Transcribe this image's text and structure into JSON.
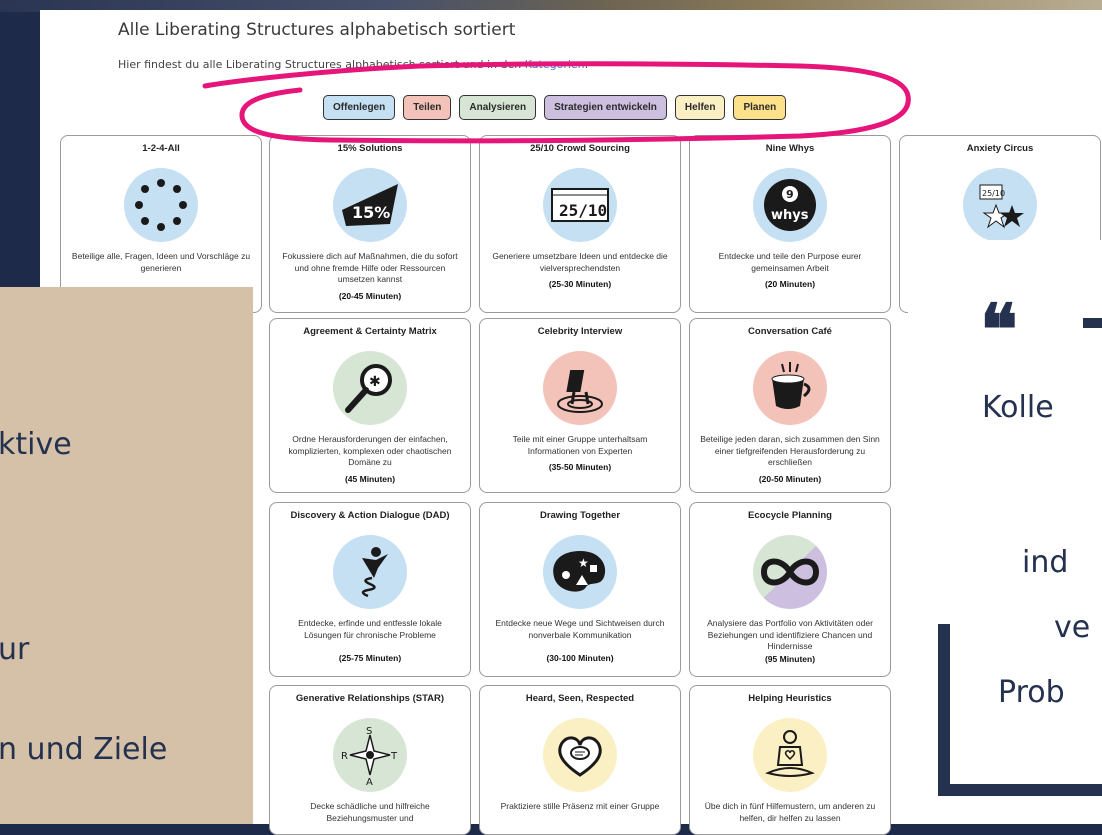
{
  "page": {
    "title": "Alle Liberating Structures alphabetisch sortiert",
    "intro_text": "Hier findest du alle Liberating Structures alphabetisch sortiert und in den",
    "intro_link": "Kategorien",
    "intro_colon": ":"
  },
  "categories": [
    {
      "label": "Offenlegen",
      "color": "#c5dff3"
    },
    {
      "label": "Teilen",
      "color": "#f3c2b8"
    },
    {
      "label": "Analysieren",
      "color": "#d7e6d4"
    },
    {
      "label": "Strategien entwickeln",
      "color": "#cdbfe0"
    },
    {
      "label": "Helfen",
      "color": "#fbefc4"
    },
    {
      "label": "Planen",
      "color": "#fde08a"
    }
  ],
  "cards": [
    {
      "title": "1-2-4-All",
      "icon": "circle-of-people-icon",
      "desc": "Beteilige alle, Fragen, Ideen und Vorschläge zu generieren",
      "duration": ""
    },
    {
      "title": "15% Solutions",
      "icon": "fifteen-percent-icon",
      "desc": "Fokussiere dich auf Maßnahmen, die du sofort und ohne fremde Hilfe oder Ressourcen umsetzen kannst",
      "duration": "(20-45 Minuten)"
    },
    {
      "title": "25/10 Crowd Sourcing",
      "icon": "scorecard-icon",
      "desc": "Generiere umsetzbare Ideen und entdecke die vielversprechendsten",
      "duration": "(25-30 Minuten)"
    },
    {
      "title": "Nine Whys",
      "icon": "nine-whys-icon",
      "desc": "Entdecke und teile den Purpose eurer gemeinsamen Arbeit",
      "duration": "(20 Minuten)"
    },
    {
      "title": "Anxiety Circus",
      "icon": "anxiety-circus-icon",
      "desc": "",
      "duration": ""
    },
    {
      "title": "Agreement & Certainty Matrix",
      "icon": "magnifier-icon",
      "desc": "Ordne Herausforderungen der einfachen, komplizierten, komplexen oder chaotischen Domäne zu",
      "duration": "(45 Minuten)"
    },
    {
      "title": "Celebrity Interview",
      "icon": "chair-spotlight-icon",
      "desc": "Teile mit einer Gruppe unterhaltsam Informationen von Experten",
      "duration": "(35-50 Minuten)"
    },
    {
      "title": "Conversation Café",
      "icon": "coffee-cup-icon",
      "desc": "Beteilige jeden daran, sich zusammen den Sinn einer tiefgreifenden Herausforderung zu erschließen",
      "duration": "(20-50 Minuten)"
    },
    {
      "title": "Discovery & Action Dialogue (DAD)",
      "icon": "spring-figure-icon",
      "desc": "Entdecke, erfinde und entfessle lokale Lösungen für chronische Probleme",
      "duration": "(25-75 Minuten)"
    },
    {
      "title": "Drawing Together",
      "icon": "palette-icon",
      "desc": "Entdecke neue Wege und Sichtweisen durch nonverbale Kommunikation",
      "duration": "(30-100 Minuten)"
    },
    {
      "title": "Ecocycle Planning",
      "icon": "infinity-icon",
      "desc": "Analysiere das Portfolio von Aktivitäten oder Beziehungen und identifiziere Chancen und Hindernisse",
      "duration": "(95 Minuten)"
    },
    {
      "title": "Generative Relationships (STAR)",
      "icon": "compass-star-icon",
      "desc": "Decke schädliche und hilfreiche Beziehungsmuster und",
      "duration": ""
    },
    {
      "title": "Heard, Seen, Respected",
      "icon": "heart-speech-icon",
      "desc": "Praktiziere stille Präsenz mit einer Gruppe",
      "duration": ""
    },
    {
      "title": "Helping Heuristics",
      "icon": "meditating-figure-icon",
      "desc": "Übe dich in fünf Hilfemustern, um anderen zu helfen, dir helfen zu lassen",
      "duration": ""
    }
  ],
  "overlay_left": {
    "lines": [
      "ktive",
      "ur",
      "n und Ziele"
    ],
    "color": "#25324f"
  },
  "overlay_right": {
    "quote_mark": "❝",
    "lines": [
      "Kolle",
      "ind",
      "ve",
      "Prob"
    ],
    "color": "#25324f"
  },
  "highlight_color": "#e6157a"
}
